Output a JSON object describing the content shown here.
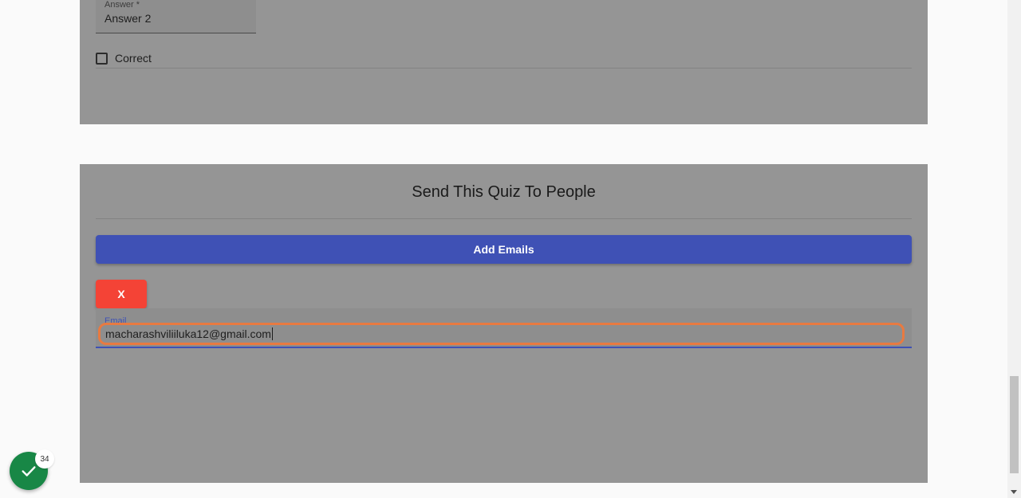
{
  "question_card": {
    "answer_label": "Answer *",
    "answer_value": "Answer 2",
    "correct_label": "Correct"
  },
  "send_card": {
    "title": "Send This Quiz To People",
    "add_emails_label": "Add Emails",
    "remove_label": "X",
    "email_label": "Email",
    "email_value": "macharashviliiluka12@gmail.com"
  },
  "status": {
    "badge_count": "34",
    "icon": "check-icon"
  },
  "colors": {
    "primary": "#3f51b5",
    "danger": "#f44336",
    "success": "#188746",
    "focus_ring": "#e87a41"
  }
}
